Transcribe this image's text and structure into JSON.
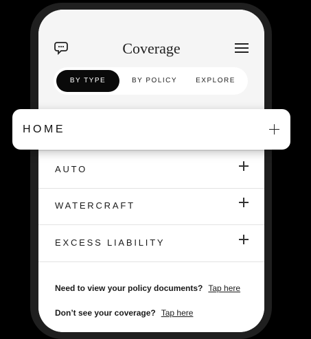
{
  "header": {
    "title": "Coverage",
    "chat_icon": "chat-bubbles-icon",
    "menu_icon": "hamburger-menu-icon"
  },
  "tabs": [
    {
      "label": "BY TYPE",
      "active": true
    },
    {
      "label": "BY POLICY",
      "active": false
    },
    {
      "label": "EXPLORE",
      "active": false
    }
  ],
  "coverage_types": [
    {
      "label": "HOME",
      "highlighted": true
    },
    {
      "label": "AUTO"
    },
    {
      "label": "WATERCRAFT"
    },
    {
      "label": "EXCESS LIABILITY"
    }
  ],
  "footer": {
    "documents_prompt": "Need to view your policy documents?",
    "documents_link": "Tap here",
    "coverage_prompt": "Don’t see your coverage?",
    "coverage_link": "Tap here"
  },
  "colors": {
    "background": "#000000",
    "screen": "#f5f5f5",
    "active_tab": "#0a0a0a"
  }
}
